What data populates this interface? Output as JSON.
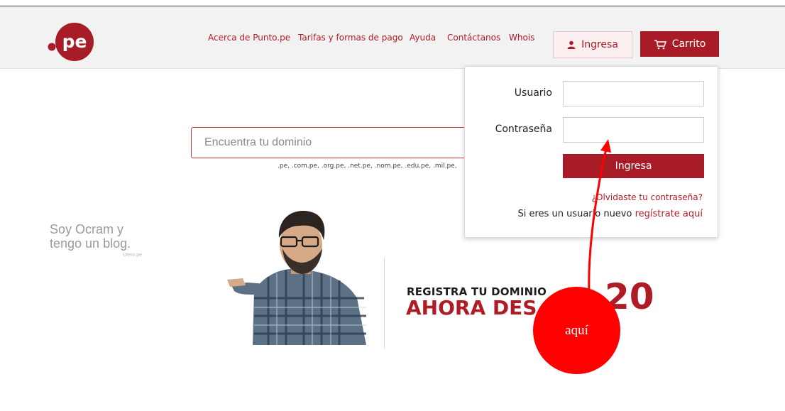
{
  "header": {
    "logo_text": ".pe",
    "brand_color": "#a71c27",
    "nav": [
      {
        "label": "Acerca de Punto.pe"
      },
      {
        "label": "Tarifas y formas de pago"
      },
      {
        "label": "Ayuda"
      },
      {
        "label": "Contáctanos"
      },
      {
        "label": "Whois"
      }
    ],
    "login_label": "Ingresa",
    "login_icon": "user-icon",
    "cart_label": "Carrito",
    "cart_icon": "cart-icon"
  },
  "search": {
    "placeholder": "Encuentra tu dominio",
    "value": "",
    "tld_hint": ".pe, .com.pe, .org.pe, .net.pe, .nom.pe, .edu.pe, .mil.pe,"
  },
  "login_popup": {
    "username_label": "Usuario",
    "username_value": "",
    "password_label": "Contraseña",
    "password_value": "",
    "submit_label": "Ingresa",
    "forgot_link": "¿Olvidaste tu contraseña?",
    "new_user_text": "Si eres un usuario nuevo",
    "register_link": "regístrate aquí"
  },
  "promo": {
    "tagline_line1": "Soy Ocram y",
    "tagline_line2": "tengo un blog.",
    "tagline_small": "Utero.pe",
    "headline_small": "REGISTRA TU DOMINIO",
    "headline_big": "AHORA DES",
    "price": "20"
  },
  "annotation": {
    "label": "aquí",
    "color": "#ff0000"
  }
}
